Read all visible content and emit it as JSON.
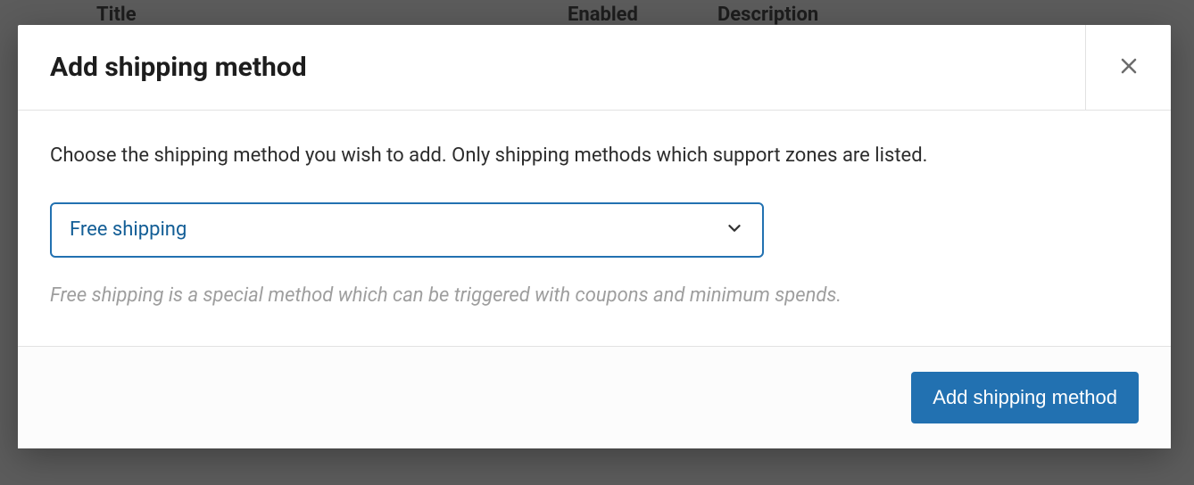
{
  "background": {
    "columns": {
      "title": "Title",
      "enabled": "Enabled",
      "description": "Description"
    }
  },
  "modal": {
    "title": "Add shipping method",
    "body_text": "Choose the shipping method you wish to add. Only shipping methods which support zones are listed.",
    "select": {
      "value": "Free shipping"
    },
    "helper_text": "Free shipping is a special method which can be triggered with coupons and minimum spends.",
    "footer": {
      "submit_label": "Add shipping method"
    }
  }
}
